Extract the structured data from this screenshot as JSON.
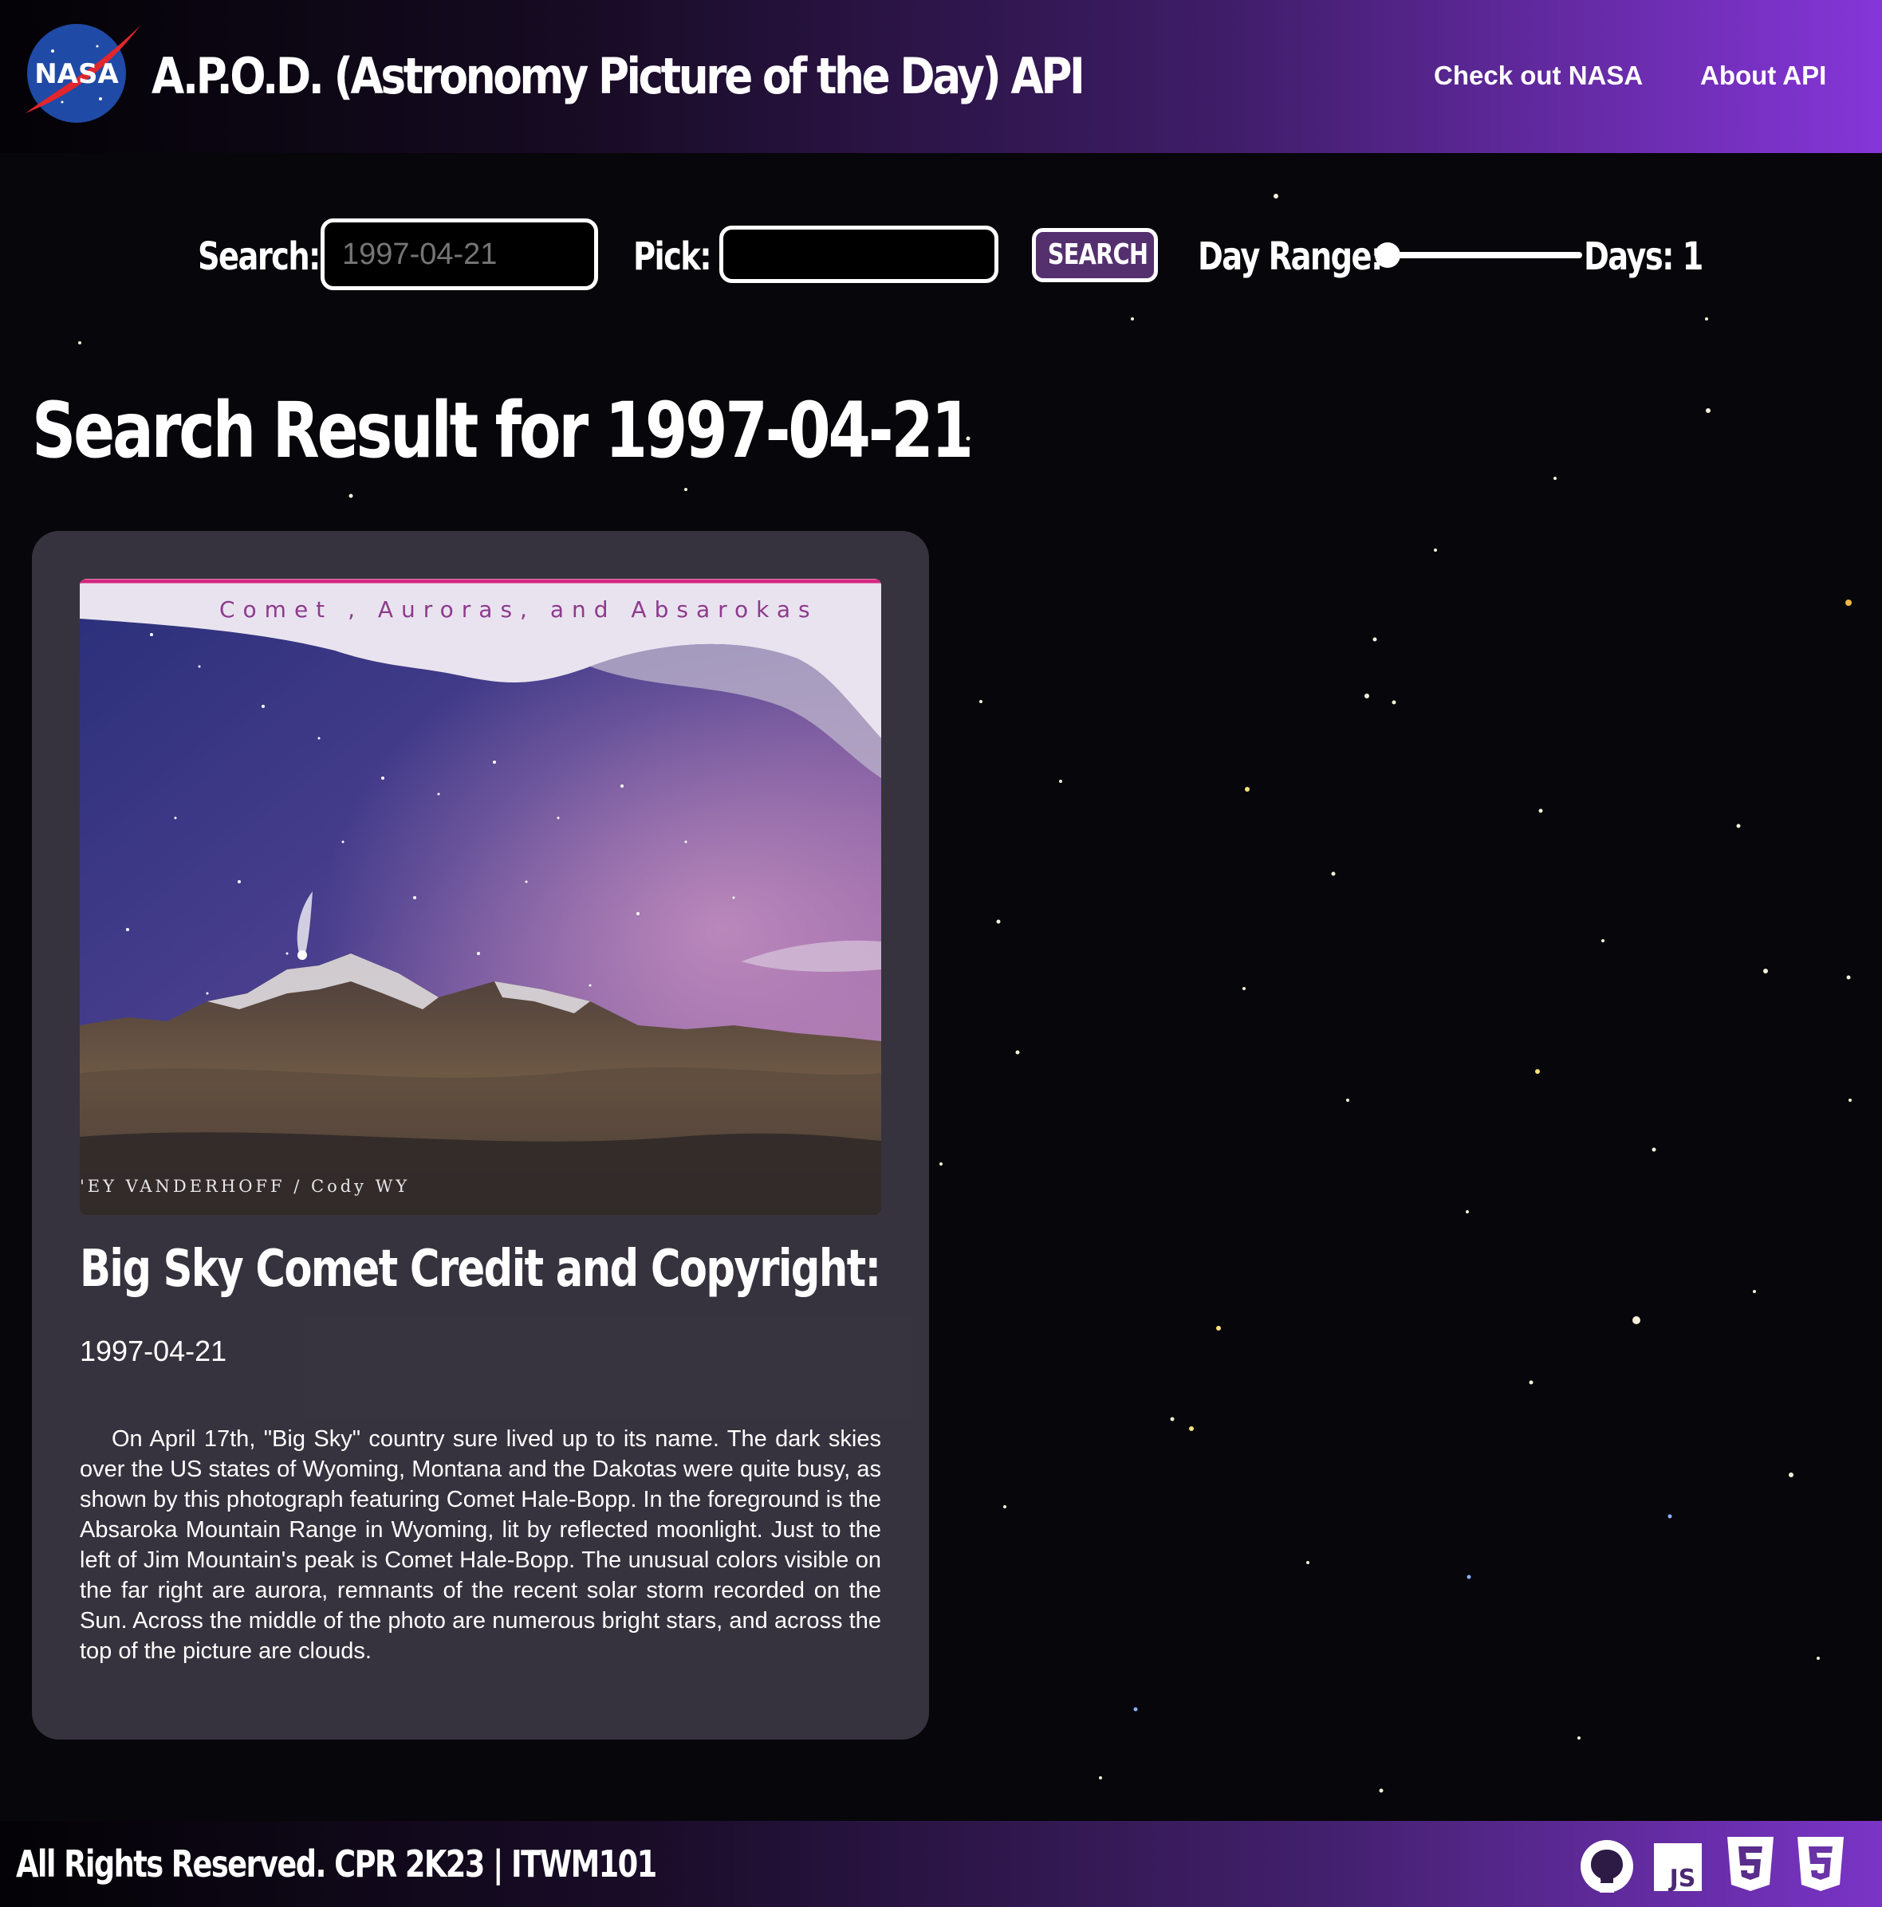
{
  "header": {
    "logo_text": "NASA",
    "title": "A.P.O.D. (Astronomy Picture of the Day) API",
    "nav": [
      "Check out NASA",
      "About API"
    ]
  },
  "search_bar": {
    "search_label": "Search:",
    "search_placeholder": "1997-04-21",
    "pick_label": "Pick:",
    "pick_value": "",
    "button_label": "SEARCH",
    "range_label": "Day Range:",
    "range_value": 1,
    "days_text": "Days: 1"
  },
  "result": {
    "heading": "Search Result for 1997-04-21",
    "image_caption_top": "Comet , Auroras, and Absarokas",
    "image_caption_bottom": "'EY VANDERHOFF / Cody WY",
    "title": "Big Sky Comet Credit and Copyright:",
    "date": "1997-04-21",
    "explanation": "On April 17th, \"Big Sky\" country sure lived up to its name. The dark skies over the US states of Wyoming, Montana and the Dakotas were quite busy, as shown by this photograph featuring Comet Hale-Bopp. In the foreground is the Absaroka Mountain Range in Wyoming, lit by reflected moonlight. Just to the left of Jim Mountain's peak is Comet Hale-Bopp. The unusual colors visible on the far right are aurora, remnants of the recent solar storm recorded on the Sun. Across the middle of the photo are numerous bright stars, and across the top of the picture are clouds."
  },
  "footer": {
    "text": "All Rights Reserved. CPR 2K23 | ITWM101",
    "js_badge": "JS",
    "icons": [
      "github-icon",
      "javascript-icon",
      "html5-icon",
      "css3-icon"
    ]
  },
  "colors": {
    "header_gradient_end": "#8536d8",
    "button_bg": "#54306f",
    "card_bg": "#3e3a46"
  }
}
